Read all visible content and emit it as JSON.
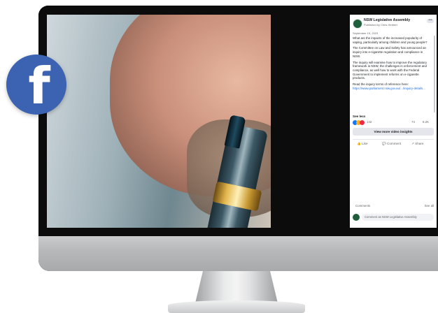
{
  "facebook_badge": {
    "letter": "f",
    "icon": "facebook-logo-icon",
    "color": "#3b63b1"
  },
  "post": {
    "page_name": "NSW Legislative Assembly",
    "published_by": "Published by Chris Herbert",
    "date": "September 15, 2023",
    "paragraphs": [
      "What are the impacts of the increased popularity of vaping, particularly among children and young people?",
      "The Committee on Law and Safety has announced an inquiry into e-cigarette regulation and compliance in NSW.",
      "The inquiry will examine how to improve the regulatory framework in NSW, the challenges in enforcement and compliance, as well how to work with the Federal Government to implement reforms on e-cigarette products.",
      "Read the inquiry terms of reference here:"
    ],
    "link_text": "https://www.parliament.nsw.gov.au/.../inquiry-details...",
    "see_less": "See less",
    "reaction_count": "142",
    "comment_count": "74",
    "view_count": "8.2K",
    "insights_button": "View more video insights",
    "actions": {
      "like": "Like",
      "comment": "Comment",
      "share": "Share"
    },
    "comments_label": "Comments",
    "see_all": "See all",
    "comment_placeholder": "Comment as NSW Legislative Assembly"
  },
  "colors": {
    "accent": "#1877f2",
    "link": "#216fdb",
    "page_avatar": "#1f5e3a"
  }
}
